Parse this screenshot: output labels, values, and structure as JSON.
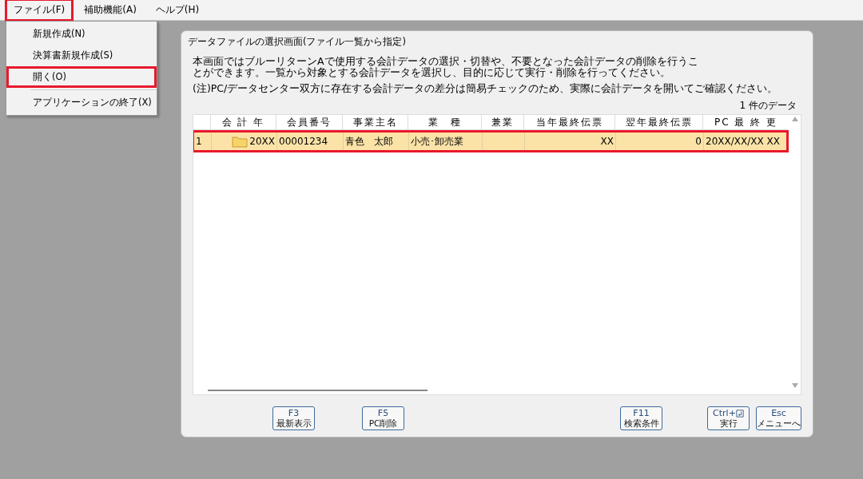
{
  "menu_bar": [
    {
      "label": "ファイル(F)",
      "selected": true
    },
    {
      "label": "補助機能(A)",
      "selected": false
    },
    {
      "label": "ヘルプ(H)",
      "selected": false
    }
  ],
  "file_menu": [
    {
      "label": "新規作成(N)",
      "selected": false,
      "separator_after": false
    },
    {
      "label": "決算書新規作成(S)",
      "selected": false,
      "separator_after": false
    },
    {
      "label": "開く(O)",
      "selected": true,
      "separator_after": true
    },
    {
      "label": "アプリケーションの終了(X)",
      "selected": false,
      "separator_after": false
    }
  ],
  "dialog": {
    "title": "データファイルの選択画面(ファイル一覧から指定)",
    "description": "本画面ではブルーリターンAで使用する会計データの選択・切替や、不要となった会計データの削除を行うことができます。一覧から対象とする会計データを選択し、目的に応じて実行・削除を行ってください。",
    "note": "(注)PC/データセンター双方に存在する会計データの差分は簡易チェックのため、実際に会計データを開いてご確認ください。",
    "count": "1 件のデータ",
    "table": {
      "columns": [
        "",
        "会 計 年",
        "会員番号",
        "事業主名",
        "業　種",
        "兼業",
        "当年最終伝票",
        "翌年最終伝票",
        "PC 最 終 更"
      ],
      "rows": [
        {
          "selected": true,
          "cells": [
            "1",
            "20XX",
            "00001234",
            "青色　太郎",
            "小売･卸売業",
            "",
            "XX",
            "0",
            "20XX/XX/XX XX"
          ]
        }
      ]
    },
    "buttons": [
      {
        "key": "F3",
        "label": "最新表示",
        "kind": "plain"
      },
      {
        "key": "F5",
        "label": "PC削除",
        "kind": "plain"
      },
      {
        "key": "F11",
        "label": "検索条件",
        "kind": "plain"
      },
      {
        "key": "Ctrl+",
        "label": "実行",
        "kind": "enter"
      },
      {
        "key": "Esc",
        "label": "メニューへ",
        "kind": "plain"
      }
    ]
  }
}
